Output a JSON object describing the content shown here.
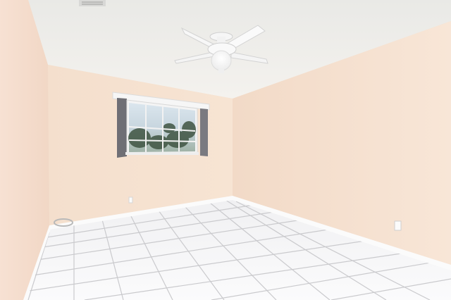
{
  "scene": {
    "kind": "empty room interior photo",
    "colors": {
      "ceiling": "#eeeeea",
      "back_wall": "#f6e3d2",
      "left_wall": "#f5ded0",
      "right_wall": "#f6e0cf",
      "floor": "#f7f7f8",
      "grout": "#c9c9cc",
      "baseboard": "#fbfbfb",
      "window_frame": "#f4f4f4",
      "curtain": "#6f6f75",
      "glass_sky": "#d7e4ec",
      "foliage": "#3f5442",
      "fan_body": "#f8f8f8",
      "fan_light": "#ffffff"
    },
    "objects": [
      "ceiling-fan",
      "window",
      "curtains",
      "baseboard",
      "tile-floor",
      "outlet",
      "vent"
    ]
  }
}
